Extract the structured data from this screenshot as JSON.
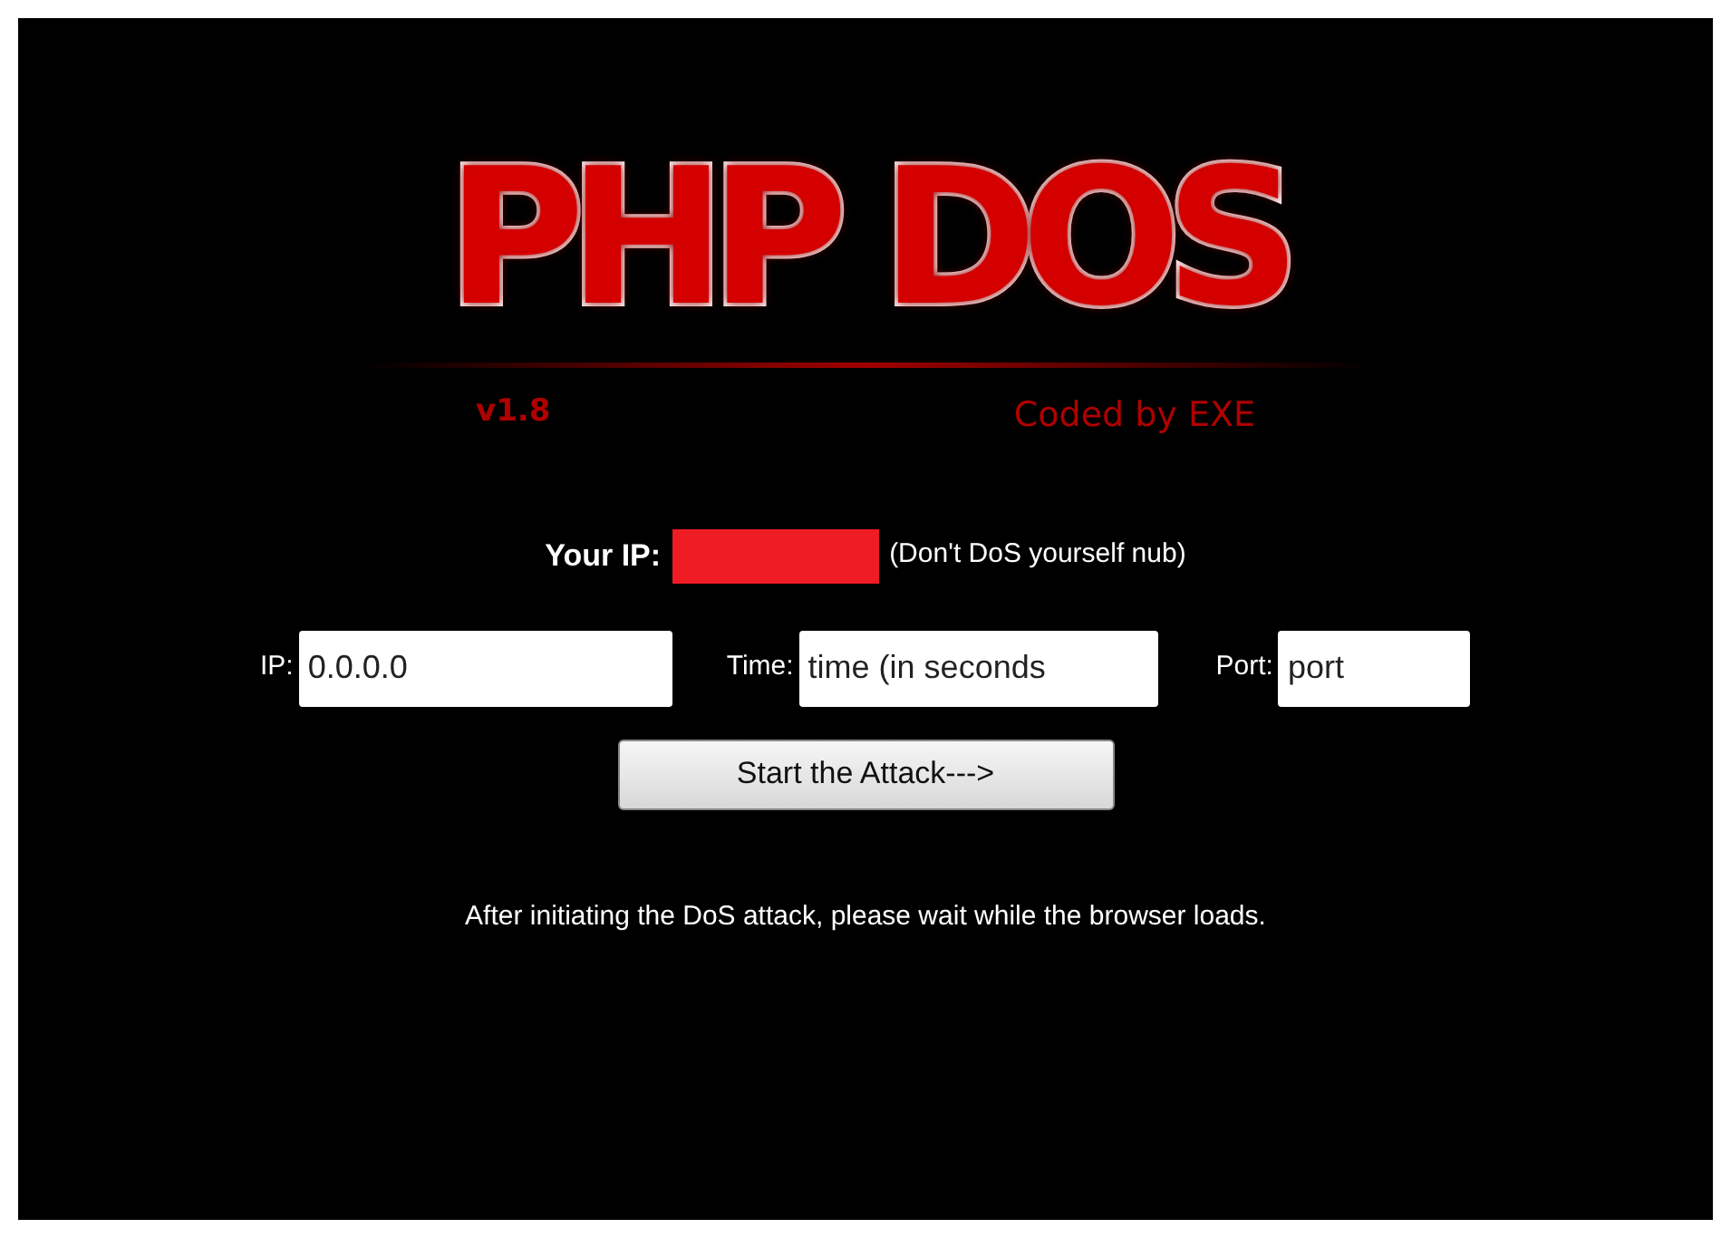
{
  "logo": {
    "title": "PHP DOS",
    "version": "v1.8",
    "credit": "Coded by EXE"
  },
  "your_ip": {
    "label": "Your IP:",
    "redacted": true,
    "note": "(Don't DoS yourself nub)"
  },
  "fields": [
    {
      "label": "IP:",
      "value": "0.0.0.0",
      "kind": "wide"
    },
    {
      "label": "Time:",
      "value": "time (in seconds",
      "kind": "medium"
    },
    {
      "label": "Port:",
      "value": "port",
      "kind": "narrow"
    }
  ],
  "button": {
    "label": "Start the Attack--->"
  },
  "message": "After initiating the DoS attack, please wait while the browser loads."
}
